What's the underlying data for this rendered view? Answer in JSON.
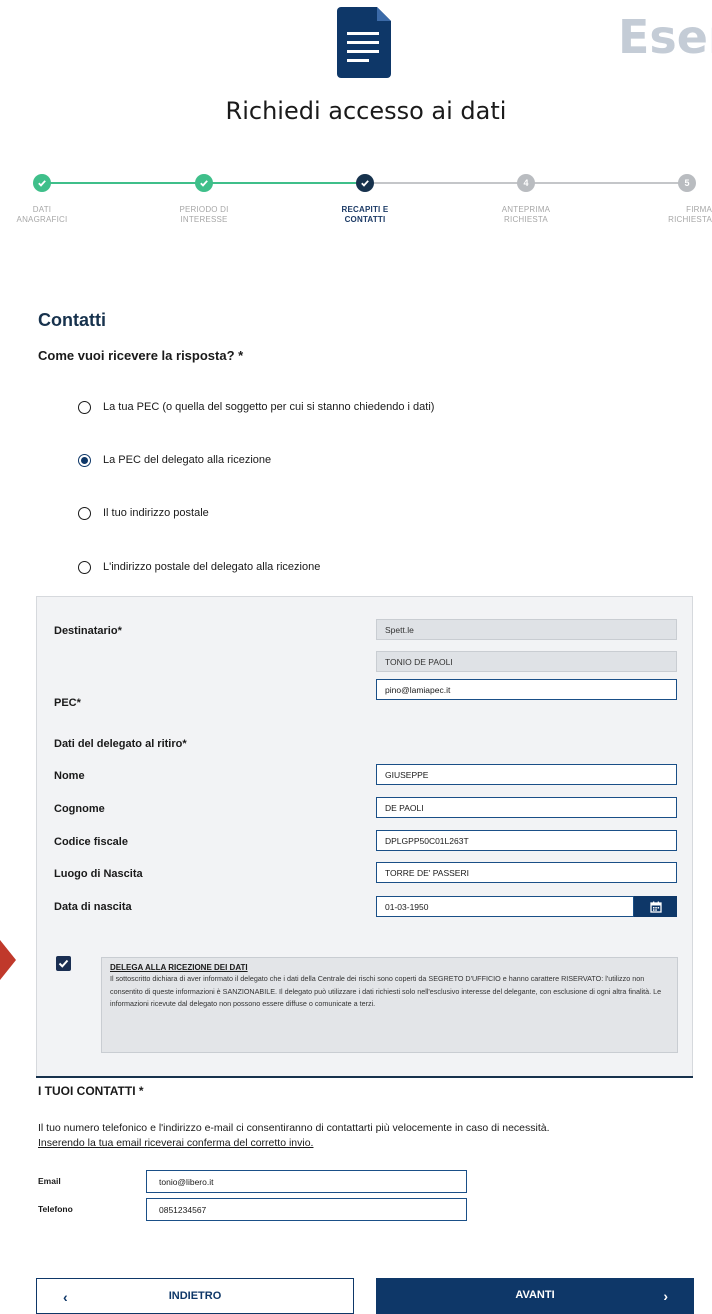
{
  "header": {
    "watermark": "Eser",
    "title": "Richiedi accesso ai dati"
  },
  "stepper": {
    "steps": [
      {
        "label1": "DATI",
        "label2": "ANAGRAFICI",
        "state": "done",
        "number": ""
      },
      {
        "label1": "PERIODO DI",
        "label2": "INTERESSE",
        "state": "done",
        "number": ""
      },
      {
        "label1": "RECAPITI E",
        "label2": "CONTATTI",
        "state": "current",
        "number": ""
      },
      {
        "label1": "ANTEPRIMA",
        "label2": "RICHIESTA",
        "state": "todo",
        "number": "4"
      },
      {
        "label1": "FIRMA",
        "label2": "RICHIESTA",
        "state": "todo",
        "number": "5"
      }
    ],
    "colors": {
      "done": "#3fbf8a",
      "current": "#17324d",
      "todo": "#b9bcc0"
    }
  },
  "contatti": {
    "title": "Contatti",
    "question": "Come vuoi ricevere la risposta? *",
    "options": [
      {
        "label": "La tua PEC (o quella del soggetto per cui si stanno chiedendo i dati)",
        "checked": false
      },
      {
        "label": "La PEC del delegato alla ricezione",
        "checked": true
      },
      {
        "label": "Il tuo indirizzo postale",
        "checked": false
      },
      {
        "label": "L'indirizzo postale del delegato alla ricezione",
        "checked": false
      }
    ]
  },
  "panel": {
    "destinatario_label": "Destinatario*",
    "destinatario_value1": "Spett.le",
    "destinatario_value2": "TONIO DE PAOLI",
    "pec_label": "PEC*",
    "pec_value": "pino@lamiapec.it",
    "delegato_heading": "Dati del delegato al ritiro*",
    "fields": {
      "nome": {
        "label": "Nome",
        "value": "GIUSEPPE"
      },
      "cognome": {
        "label": "Cognome",
        "value": "DE PAOLI"
      },
      "cf": {
        "label": "Codice fiscale",
        "value": "DPLGPP50C01L263T"
      },
      "luogo": {
        "label": "Luogo di Nascita",
        "value": "TORRE DE' PASSERI"
      },
      "data": {
        "label": "Data di nascita",
        "value": "01-03-1950"
      }
    },
    "delega": {
      "checked": true,
      "title": "DELEGA ALLA RICEZIONE DEI DATI",
      "text": "Il sottoscritto dichiara di aver informato il delegato che i dati della Centrale dei rischi sono coperti da SEGRETO D'UFFICIO e hanno carattere RISERVATO: l'utilizzo non consentito di queste informazioni è SANZIONABILE. Il delegato può utilizzare i dati richiesti solo nell'esclusivo interesse del delegante, con esclusione di ogni altra finalità. Le informazioni ricevute dal delegato non possono essere diffuse o comunicate a terzi."
    }
  },
  "tuoi_contatti": {
    "title": "I TUOI CONTATTI *",
    "text": "Il tuo numero telefonico e l'indirizzo e-mail ci consentiranno di contattarti più velocemente in caso di necessità.",
    "text_underlined": "Inserendo la tua email riceverai conferma del corretto invio.",
    "email_label": "Email",
    "email_value": "tonio@libero.it",
    "telefono_label": "Telefono",
    "telefono_value": "0851234567"
  },
  "buttons": {
    "back_label": "INDIETRO",
    "next_label": "AVANTI"
  }
}
